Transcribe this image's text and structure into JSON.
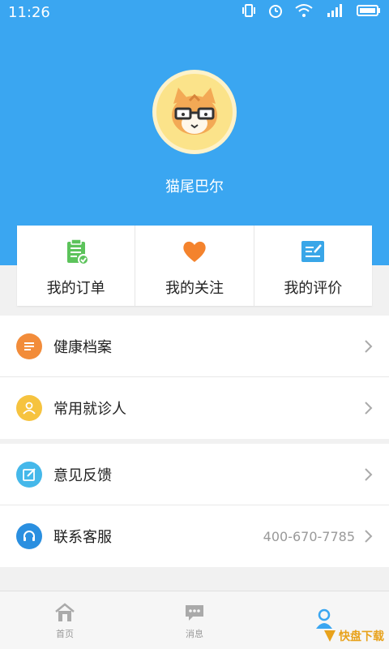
{
  "status_bar": {
    "time": "11:26"
  },
  "profile": {
    "username": "猫尾巴尔"
  },
  "quick_actions": [
    {
      "label": "我的订单",
      "icon": "order-clipboard-icon",
      "color": "#5cc35b"
    },
    {
      "label": "我的关注",
      "icon": "heart-icon",
      "color": "#f4832d"
    },
    {
      "label": "我的评价",
      "icon": "review-edit-icon",
      "color": "#39a6e8"
    }
  ],
  "menu_group_1": [
    {
      "label": "健康档案",
      "icon": "health-record-icon",
      "color": "#f28c3a"
    },
    {
      "label": "常用就诊人",
      "icon": "patient-icon",
      "color": "#f6c33f"
    }
  ],
  "menu_group_2": [
    {
      "label": "意见反馈",
      "icon": "feedback-icon",
      "color": "#45b8ea"
    },
    {
      "label": "联系客服",
      "icon": "headset-icon",
      "color": "#2a8fe0",
      "value": "400-670-7785"
    }
  ],
  "tabs": [
    {
      "label": "首页",
      "icon": "home-icon",
      "active": false
    },
    {
      "label": "消息",
      "icon": "message-icon",
      "active": false
    },
    {
      "label": "",
      "icon": "profile-icon",
      "active": true
    }
  ],
  "watermark": {
    "brand": "快盘下载"
  },
  "colors": {
    "primary": "#3aa6f1",
    "background": "#f1f1f1"
  }
}
